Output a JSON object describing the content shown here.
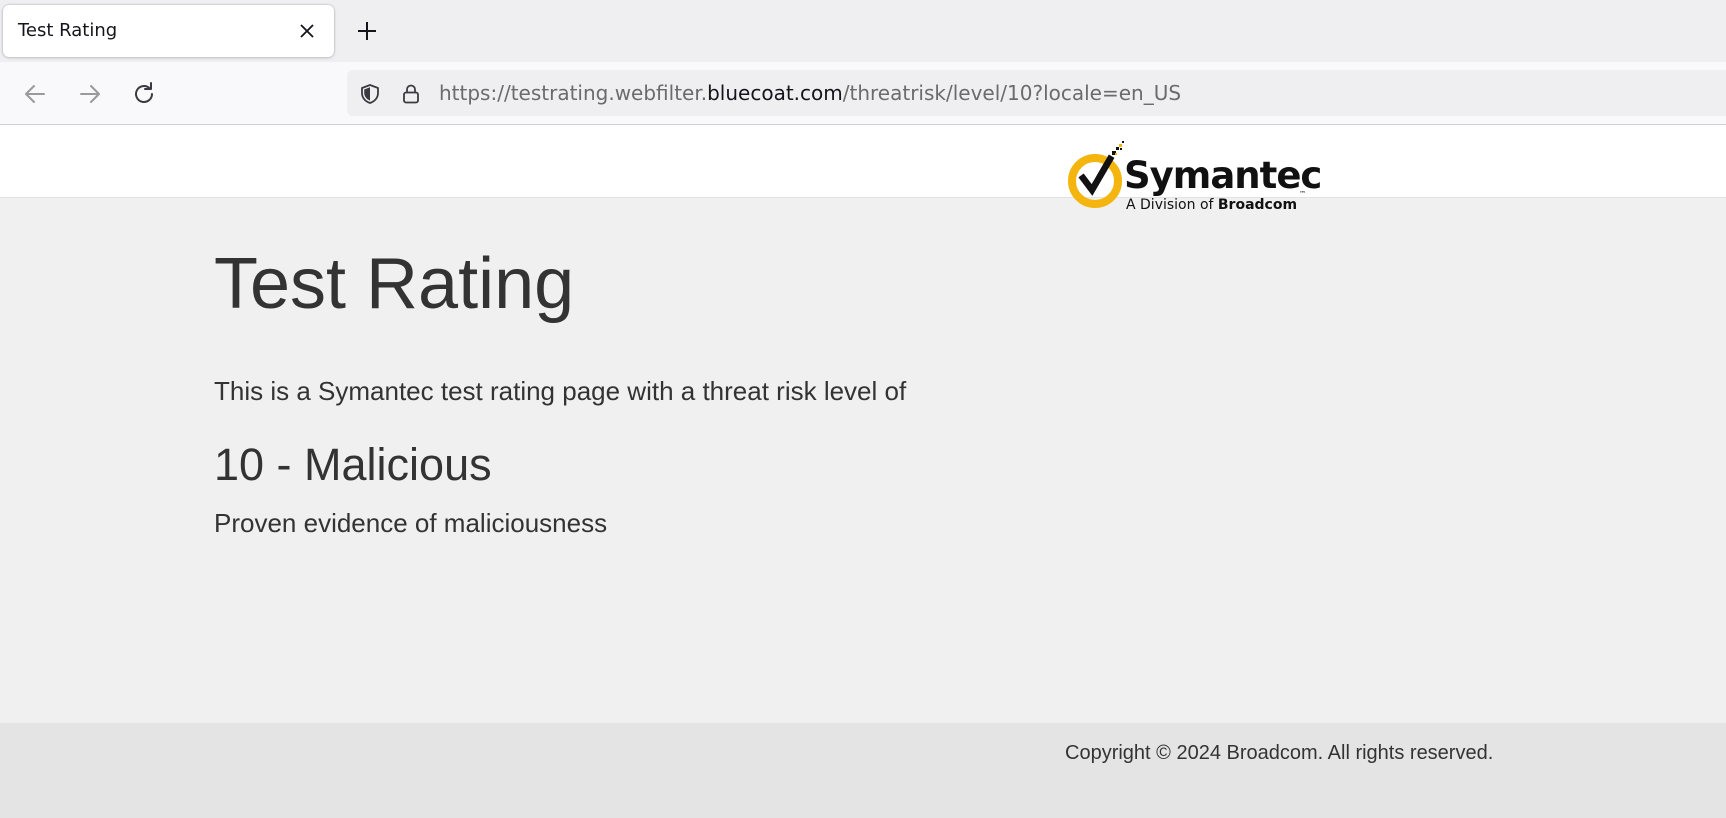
{
  "browser": {
    "tab": {
      "title": "Test Rating",
      "close_icon": "close-icon"
    },
    "new_tab_icon": "plus-icon",
    "nav": {
      "back_icon": "arrow-left-icon",
      "forward_icon": "arrow-right-icon",
      "reload_icon": "reload-icon"
    },
    "url": {
      "shield_icon": "shield-icon",
      "lock_icon": "lock-icon",
      "prefix": "https://testrating.webfilter.",
      "domain": "bluecoat.com",
      "suffix": "/threatrisk/level/10?locale=en_US"
    }
  },
  "header": {
    "logo": {
      "wordmark": "Symantec",
      "tm": "™",
      "subtitle_prefix": "A Division of ",
      "subtitle_brand": "Broadcom",
      "colors": {
        "ring": "#f5b50f",
        "check": "#111111"
      }
    }
  },
  "main": {
    "title": "Test Rating",
    "intro": "This is a Symantec test rating page with a threat risk level of",
    "level": "10 - Malicious",
    "description": "Proven evidence of maliciousness"
  },
  "footer": {
    "copyright": "Copyright © 2024 Broadcom. All rights reserved."
  },
  "colors": {
    "page_bg": "#f0f0f0",
    "text": "#333333",
    "footer_bg": "#e4e4e4",
    "chrome_bg": "#efeef1"
  }
}
